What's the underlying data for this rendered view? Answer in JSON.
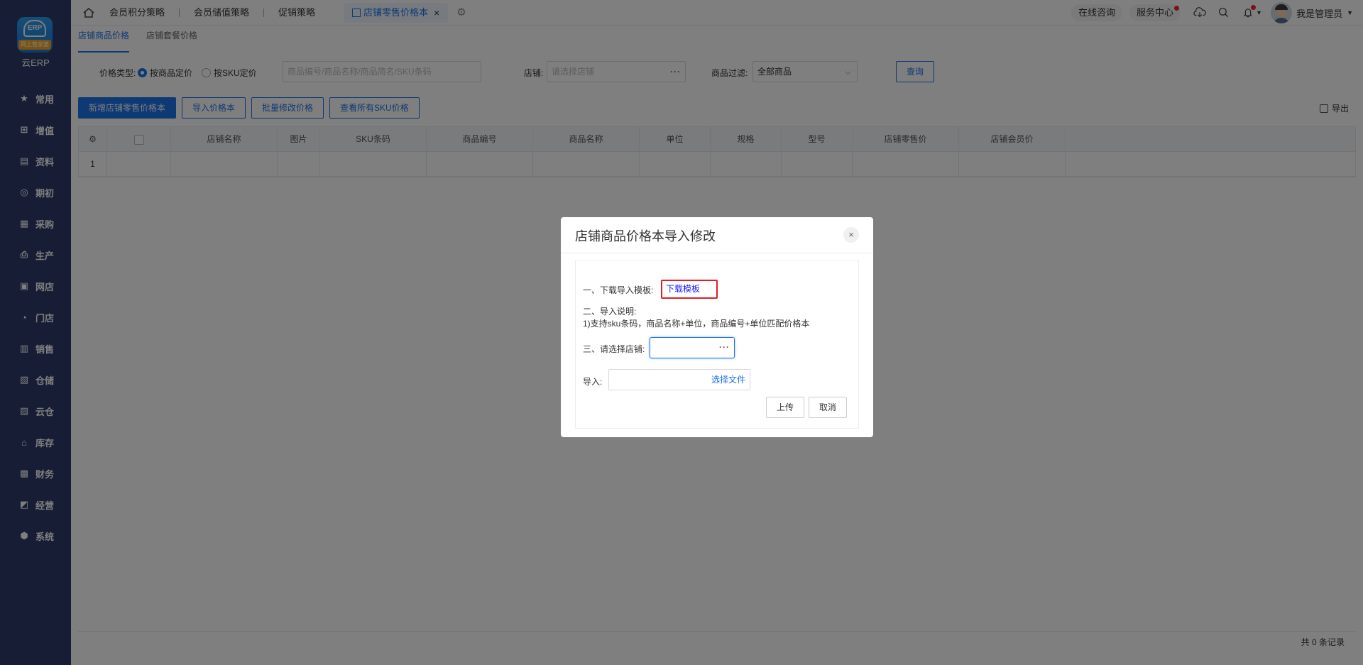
{
  "sidebar": {
    "logo_mark": "ERP",
    "logo_ribbon": "网上管家婆",
    "logo_text": "云ERP",
    "items": [
      {
        "label": "常用",
        "icon": "star-icon",
        "glyph": "★"
      },
      {
        "label": "增值",
        "icon": "plus-square-icon",
        "glyph": "⊞"
      },
      {
        "label": "资料",
        "icon": "document-icon",
        "glyph": "▤"
      },
      {
        "label": "期初",
        "icon": "target-icon",
        "glyph": "◎"
      },
      {
        "label": "采购",
        "icon": "purchase-icon",
        "glyph": "▦"
      },
      {
        "label": "生产",
        "icon": "production-icon",
        "glyph": "⎙"
      },
      {
        "label": "网店",
        "icon": "store-icon",
        "glyph": "▣"
      },
      {
        "label": "门店",
        "icon": "pie-icon",
        "glyph": "◔"
      },
      {
        "label": "销售",
        "icon": "chart-icon",
        "glyph": "▥"
      },
      {
        "label": "仓储",
        "icon": "warehouse-icon",
        "glyph": "▧"
      },
      {
        "label": "云仓",
        "icon": "cloud-warehouse-icon",
        "glyph": "▨"
      },
      {
        "label": "库存",
        "icon": "home-stock-icon",
        "glyph": "⌂"
      },
      {
        "label": "财务",
        "icon": "finance-icon",
        "glyph": "▩"
      },
      {
        "label": "经营",
        "icon": "business-icon",
        "glyph": "◩"
      },
      {
        "label": "系统",
        "icon": "system-icon",
        "glyph": "⬢"
      }
    ]
  },
  "topbar": {
    "tabs": [
      "会员积分策略",
      "会员储值策略",
      "促销策略"
    ],
    "active_tab": "店铺零售价格本",
    "active_tab_close": "×",
    "gear_glyph": "⚙",
    "online_consult": "在线咨询",
    "service_center": "服务中心",
    "user_name": "我是管理员",
    "caret": "▼",
    "bell_caret": "▾"
  },
  "subtabs": [
    "店铺商品价格",
    "店铺套餐价格"
  ],
  "filters": {
    "price_type_label": "价格类型:",
    "radio_product": "按商品定价",
    "radio_sku": "按SKU定价",
    "search_placeholder": "商品编号/商品名称/商品简名/SKU条码",
    "store_label": "店铺:",
    "store_placeholder": "请选择店铺",
    "filter_label": "商品过滤:",
    "filter_value": "全部商品",
    "query_button": "查询",
    "dots": "···",
    "chevron": "⌵"
  },
  "actions": {
    "new_button": "新增店铺零售价格本",
    "import_button": "导入价格本",
    "batch_button": "批量修改价格",
    "view_all_button": "查看所有SKU价格",
    "export_label": "导出"
  },
  "table": {
    "columns": [
      "店铺名称",
      "图片",
      "SKU条码",
      "商品编号",
      "商品名称",
      "单位",
      "规格",
      "型号",
      "店铺零售价",
      "店铺会员价"
    ],
    "row_number": "1",
    "record_count": "共 0 条记录"
  },
  "dialog": {
    "title": "店铺商品价格本导入修改",
    "close": "×",
    "step1_label": "一、下载导入模板:",
    "download_link": "下载模板",
    "step2_label": "二、导入说明:",
    "step2_desc": "1)支持sku条码，商品名称+单位，商品编号+单位匹配价格本",
    "step3_label": "三、请选择店铺:",
    "store_dots": "···",
    "import_label": "导入:",
    "choose_file": "选择文件",
    "upload_button": "上传",
    "cancel_button": "取消"
  }
}
